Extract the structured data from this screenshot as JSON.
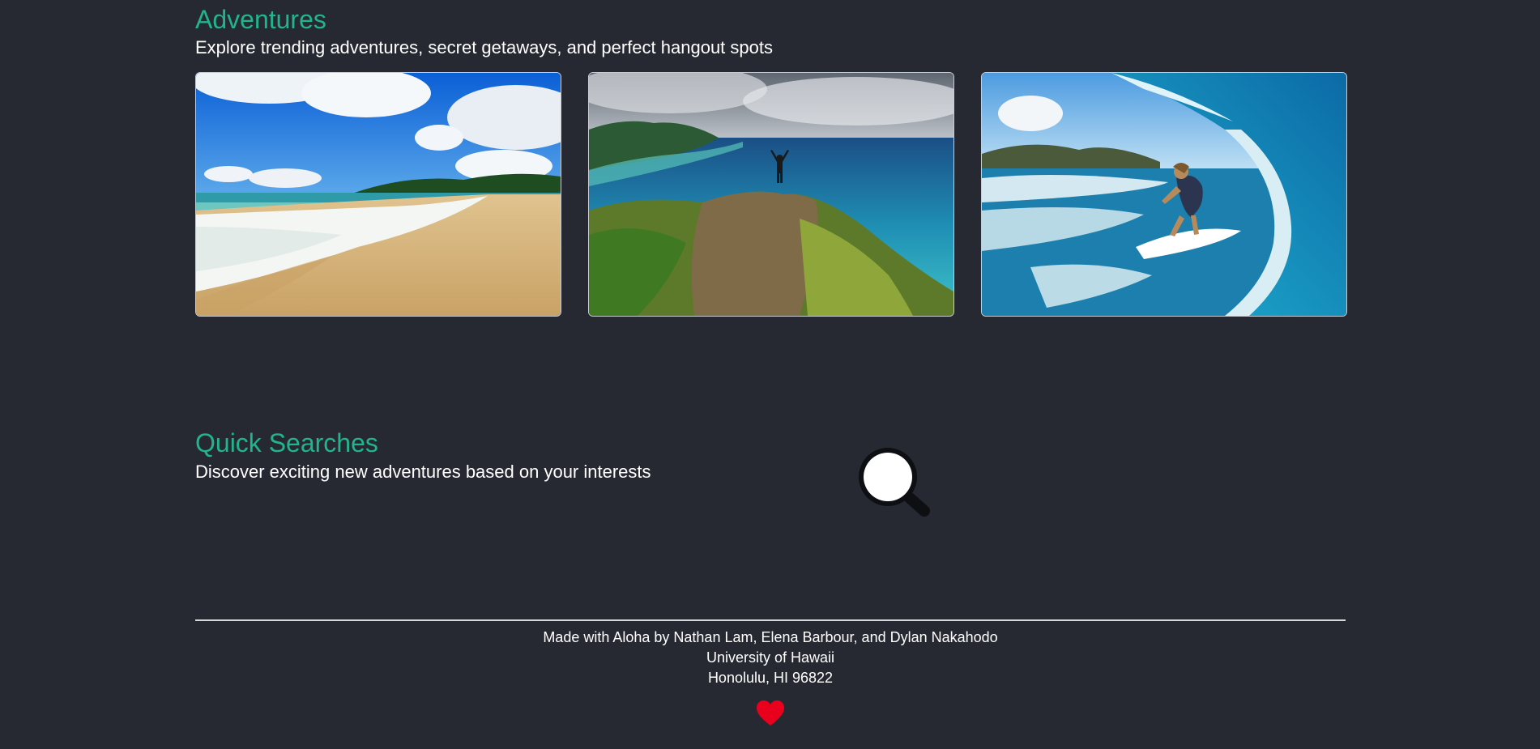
{
  "adventures": {
    "title": "Adventures",
    "subtitle": "Explore trending adventures, secret getaways, and perfect hangout spots",
    "cards": [
      {
        "image": "beach-shoreline-photo"
      },
      {
        "image": "cliff-summit-lagoon-photo"
      },
      {
        "image": "surfer-wave-barrel-photo"
      }
    ]
  },
  "quick_searches": {
    "title": "Quick Searches",
    "subtitle": "Discover exciting new adventures based on your interests",
    "icon": "search-icon"
  },
  "footer": {
    "credits": "Made with Aloha by Nathan Lam, Elena Barbour, and Dylan Nakahodo",
    "school": "University of Hawaii",
    "location": "Honolulu, HI 96822",
    "icon": "heart-icon"
  },
  "colors": {
    "background": "#262932",
    "accent": "#21b48d",
    "text": "#ffffff",
    "heart": "#e8001c"
  }
}
